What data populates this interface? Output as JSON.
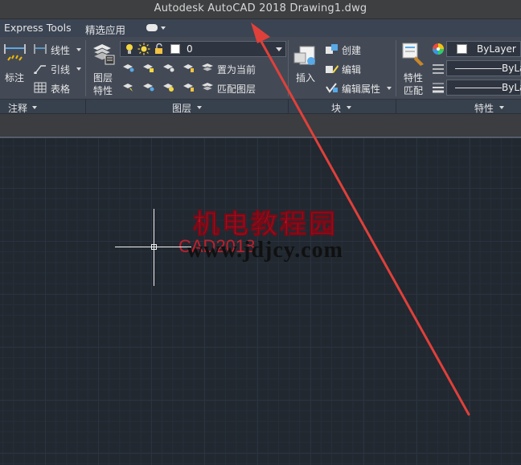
{
  "window": {
    "title": "Autodesk AutoCAD 2018    Drawing1.dwg"
  },
  "tabs": [
    {
      "label": "Express Tools"
    },
    {
      "label": "精选应用"
    }
  ],
  "annotate_panel": {
    "dimension_label": "标注",
    "linear_label": "线性",
    "leader_label": "引线",
    "table_label": "表格",
    "title": "注释"
  },
  "layers_panel": {
    "layer_properties_label_1": "图层",
    "layer_properties_label_2": "特性",
    "current_layer": "0",
    "set_current_label": "置为当前",
    "match_layer_label": "匹配图层",
    "title": "图层"
  },
  "block_panel": {
    "insert_label": "插入",
    "create_label": "创建",
    "edit_label": "编辑",
    "edit_attributes_label": "编辑属性",
    "title": "块"
  },
  "properties_panel": {
    "match_label_1": "特性",
    "match_label_2": "匹配",
    "color_value": "ByLayer",
    "linetype_value": "ByLa",
    "lineweight_value": "ByLa",
    "title": "特性"
  },
  "canvas": {
    "watermark_chinese": "机电教程园",
    "watermark_url": "www.jdjcy.com",
    "text_object": "CAD2018"
  },
  "colors": {
    "annotation_arrow": "#e0403a",
    "canvas_background": "#212830",
    "ribbon_background": "#434a56"
  }
}
